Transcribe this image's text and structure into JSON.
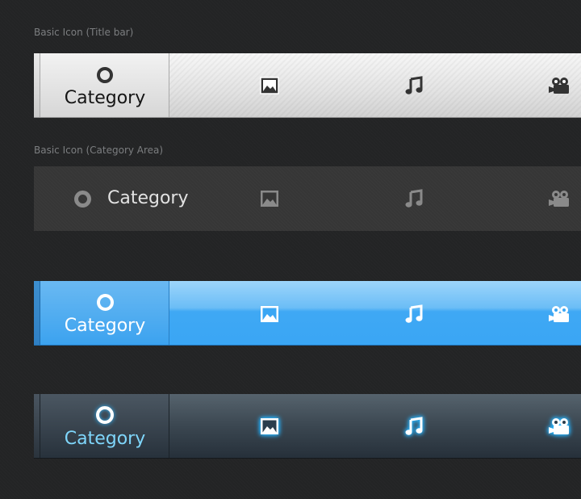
{
  "sections": [
    {
      "label": "Basic Icon (Title bar)",
      "category_label": "Category"
    },
    {
      "label": "Basic Icon (Category Area)",
      "category_label": "Category"
    },
    {
      "label": "",
      "category_label": "Category"
    },
    {
      "label": "",
      "category_label": "Category"
    }
  ],
  "icons": [
    "picture-icon",
    "music-note-icon",
    "video-camera-icon"
  ],
  "colors": {
    "background": "#232425",
    "title_bar": "#e3e3e3",
    "category_area": "#363636",
    "blue_bar": "#3aa6f4",
    "glow_bar": "#3b4751",
    "glow_accent": "#7fd6fb"
  }
}
